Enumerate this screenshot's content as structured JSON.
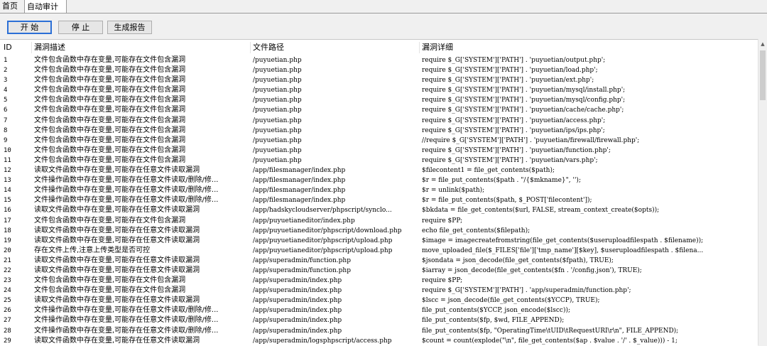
{
  "tabs": [
    {
      "label": "首页",
      "active": false
    },
    {
      "label": "自动审计",
      "active": true
    }
  ],
  "toolbar": {
    "start_label": "开 始",
    "stop_label": "停 止",
    "report_label": "生成报告"
  },
  "table": {
    "columns": [
      "ID",
      "漏洞描述",
      "文件路径",
      "漏洞详细"
    ],
    "rows": [
      [
        "1",
        "文件包含函数中存在变量,可能存在文件包含漏洞",
        "/puyuetian.php",
        "require $_G['SYSTEM']['PATH'] . 'puyuetian/output.php';"
      ],
      [
        "2",
        "文件包含函数中存在变量,可能存在文件包含漏洞",
        "/puyuetian.php",
        "require $_G['SYSTEM']['PATH'] . 'puyuetian/load.php';"
      ],
      [
        "3",
        "文件包含函数中存在变量,可能存在文件包含漏洞",
        "/puyuetian.php",
        "require $_G['SYSTEM']['PATH'] . 'puyuetian/ext.php';"
      ],
      [
        "4",
        "文件包含函数中存在变量,可能存在文件包含漏洞",
        "/puyuetian.php",
        "require $_G['SYSTEM']['PATH'] . 'puyuetian/mysql/install.php';"
      ],
      [
        "5",
        "文件包含函数中存在变量,可能存在文件包含漏洞",
        "/puyuetian.php",
        "require $_G['SYSTEM']['PATH'] . 'puyuetian/mysql/config.php';"
      ],
      [
        "6",
        "文件包含函数中存在变量,可能存在文件包含漏洞",
        "/puyuetian.php",
        "require $_G['SYSTEM']['PATH'] . 'puyuetian/cache/cache.php';"
      ],
      [
        "7",
        "文件包含函数中存在变量,可能存在文件包含漏洞",
        "/puyuetian.php",
        "require $_G['SYSTEM']['PATH'] . 'puyuetian/access.php';"
      ],
      [
        "8",
        "文件包含函数中存在变量,可能存在文件包含漏洞",
        "/puyuetian.php",
        "require $_G['SYSTEM']['PATH'] . 'puyuetian/ips/ips.php';"
      ],
      [
        "9",
        "文件包含函数中存在变量,可能存在文件包含漏洞",
        "/puyuetian.php",
        "//require $_G['SYSTEM']['PATH'] . 'puyuetian/firewall/firewall.php';"
      ],
      [
        "10",
        "文件包含函数中存在变量,可能存在文件包含漏洞",
        "/puyuetian.php",
        "require $_G['SYSTEM']['PATH'] . 'puyuetian/function.php';"
      ],
      [
        "11",
        "文件包含函数中存在变量,可能存在文件包含漏洞",
        "/puyuetian.php",
        "require $_G['SYSTEM']['PATH'] . 'puyuetian/vars.php';"
      ],
      [
        "12",
        "读取文件函数中存在变量,可能存在任意文件读取漏洞",
        "/app/filesmanager/index.php",
        "$filecontent1 = file_get_contents($path);"
      ],
      [
        "13",
        "文件操作函数中存在变量,可能存在任意文件读取/删除/修...",
        "/app/filesmanager/index.php",
        "$r = file_put_contents($path . \"/{$mkname}\", '');"
      ],
      [
        "14",
        "文件操作函数中存在变量,可能存在任意文件读取/删除/修...",
        "/app/filesmanager/index.php",
        "$r = unlink($path);"
      ],
      [
        "15",
        "文件操作函数中存在变量,可能存在任意文件读取/删除/修...",
        "/app/filesmanager/index.php",
        "$r = file_put_contents($path, $_POST['filecontent']);"
      ],
      [
        "16",
        "读取文件函数中存在变量,可能存在任意文件读取漏洞",
        "/app/hadskycloudserver/phpscript/synclo...",
        "$bkdata = file_get_contents($url, FALSE, stream_context_create($opts));"
      ],
      [
        "17",
        "文件包含函数中存在变量,可能存在文件包含漏洞",
        "/app/puyuetianeditor/index.php",
        "require $PP;"
      ],
      [
        "18",
        "读取文件函数中存在变量,可能存在任意文件读取漏洞",
        "/app/puyuetianeditor/phpscript/download.php",
        "echo file_get_contents($filepath);"
      ],
      [
        "19",
        "读取文件函数中存在变量,可能存在任意文件读取漏洞",
        "/app/puyuetianeditor/phpscript/upload.php",
        "$image = imagecreatefromstring(file_get_contents($useruploadfilespath . $filename));"
      ],
      [
        "20",
        "存在文件上传,注意上传类型是否可控",
        "/app/puyuetianeditor/phpscript/upload.php",
        "move_uploaded_file($_FILES['file']['tmp_name'][$key], $useruploadfilespath . $filena..."
      ],
      [
        "21",
        "读取文件函数中存在变量,可能存在任意文件读取漏洞",
        "/app/superadmin/function.php",
        "$jsondata = json_decode(file_get_contents($fpath), TRUE);"
      ],
      [
        "22",
        "读取文件函数中存在变量,可能存在任意文件读取漏洞",
        "/app/superadmin/function.php",
        "$iarray = json_decode(file_get_contents($fn . '/config.json'), TRUE);"
      ],
      [
        "23",
        "文件包含函数中存在变量,可能存在文件包含漏洞",
        "/app/superadmin/index.php",
        "require $PP;"
      ],
      [
        "24",
        "文件包含函数中存在变量,可能存在文件包含漏洞",
        "/app/superadmin/index.php",
        "require $_G['SYSTEM']['PATH'] . 'app/superadmin/function.php';"
      ],
      [
        "25",
        "读取文件函数中存在变量,可能存在任意文件读取漏洞",
        "/app/superadmin/index.php",
        "$lscc = json_decode(file_get_contents($YCCP), TRUE);"
      ],
      [
        "26",
        "文件操作函数中存在变量,可能存在任意文件读取/删除/修...",
        "/app/superadmin/index.php",
        "file_put_contents($YCCP, json_encode($lscc));"
      ],
      [
        "27",
        "文件操作函数中存在变量,可能存在任意文件读取/删除/修...",
        "/app/superadmin/index.php",
        "file_put_contents($fp, $wd, FILE_APPEND);"
      ],
      [
        "28",
        "文件操作函数中存在变量,可能存在任意文件读取/删除/修...",
        "/app/superadmin/index.php",
        "file_put_contents($fp, \"OperatingTime\\tUID\\tRequestURI\\r\\n\", FILE_APPEND);"
      ],
      [
        "29",
        "读取文件函数中存在变量,可能存在任意文件读取漏洞",
        "/app/superadmin/logsphpscript/access.php",
        "$count = count(explode(\"\\n\", file_get_contents($ap . $value . '/' . $_value))) - 1;"
      ]
    ]
  }
}
